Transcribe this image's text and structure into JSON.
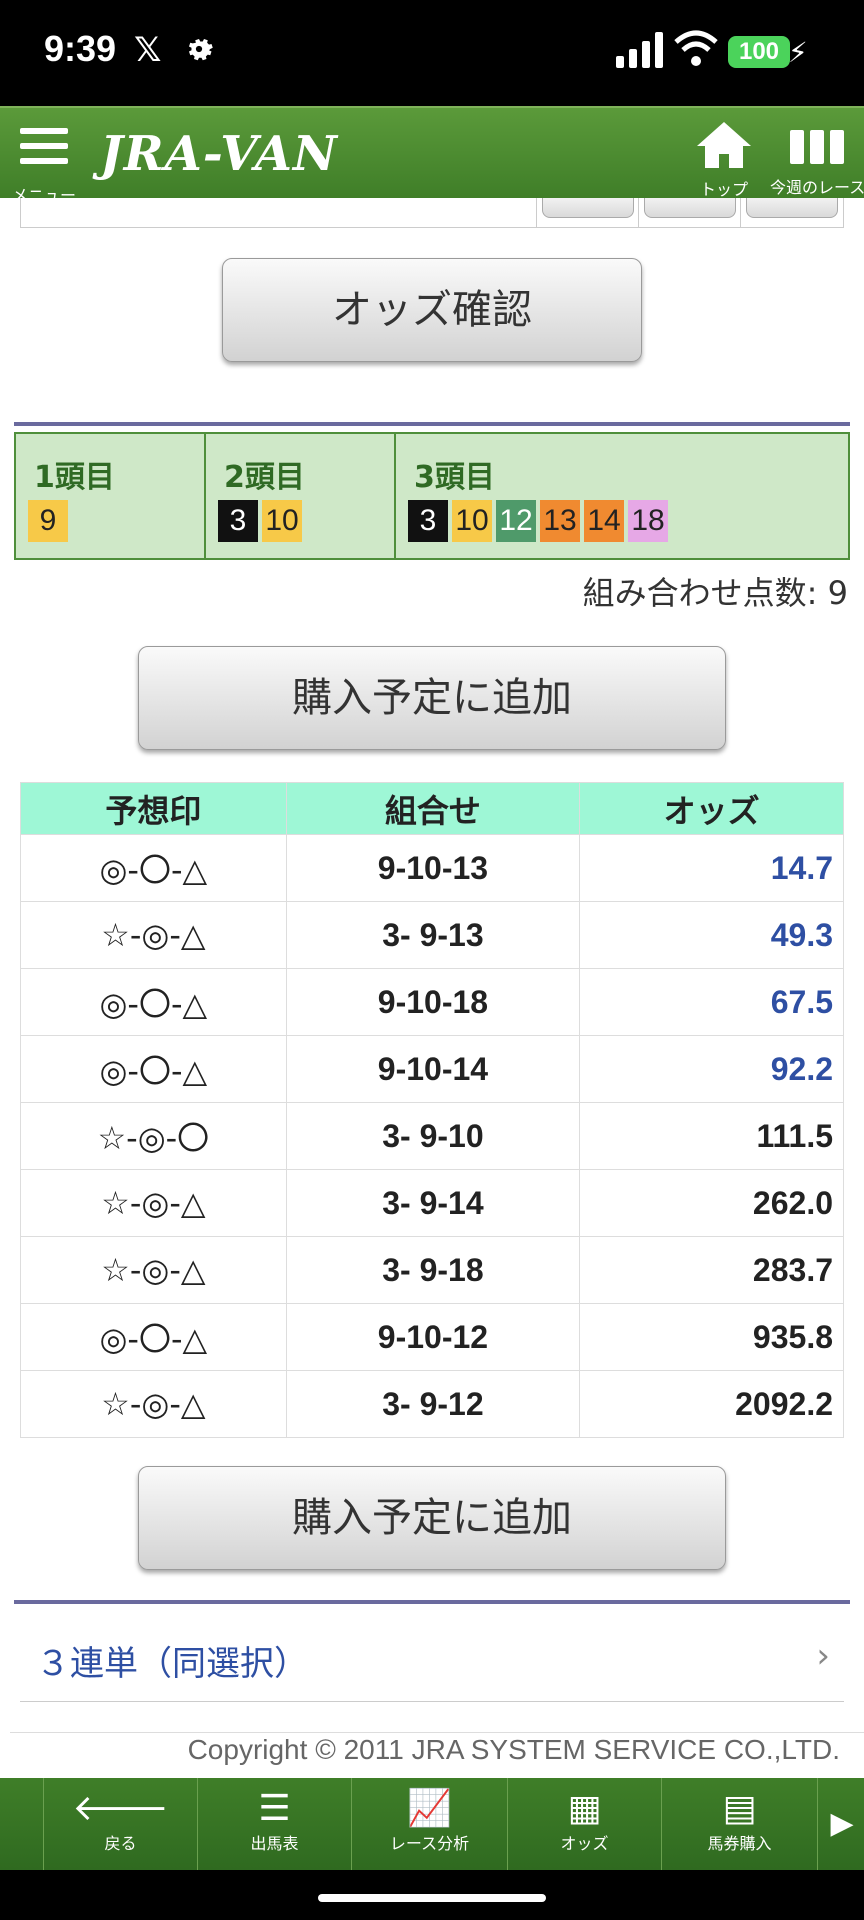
{
  "status": {
    "time": "9:39",
    "battery": "100"
  },
  "header": {
    "menu_label": "メニュー",
    "logo": "JRA-VAN",
    "top_label": "トップ",
    "week_label": "今週のレース"
  },
  "odds_confirm_label": "オッズ確認",
  "selection": {
    "cols": [
      {
        "title": "1頭目",
        "nums": [
          {
            "n": "9",
            "bg": "#f7c948",
            "fg": "#222"
          }
        ]
      },
      {
        "title": "2頭目",
        "nums": [
          {
            "n": "3",
            "bg": "#111111",
            "fg": "#fff"
          },
          {
            "n": "10",
            "bg": "#f7c948",
            "fg": "#222"
          }
        ]
      },
      {
        "title": "3頭目",
        "nums": [
          {
            "n": "3",
            "bg": "#111111",
            "fg": "#fff"
          },
          {
            "n": "10",
            "bg": "#f7c948",
            "fg": "#222"
          },
          {
            "n": "12",
            "bg": "#4f9a6a",
            "fg": "#fff"
          },
          {
            "n": "13",
            "bg": "#f08a30",
            "fg": "#222"
          },
          {
            "n": "14",
            "bg": "#f08a30",
            "fg": "#222"
          },
          {
            "n": "18",
            "bg": "#e6a8e6",
            "fg": "#222"
          }
        ]
      }
    ],
    "count_text": "組み合わせ点数: 9"
  },
  "add_button_label": "購入予定に追加",
  "table": {
    "headers": [
      "予想印",
      "組合せ",
      "オッズ"
    ],
    "rows": [
      {
        "mark": "◎-〇-△",
        "combo": "9-10-13",
        "odds": "14.7",
        "blue": true
      },
      {
        "mark": "☆-◎-△",
        "combo": "3- 9-13",
        "odds": "49.3",
        "blue": true
      },
      {
        "mark": "◎-〇-△",
        "combo": "9-10-18",
        "odds": "67.5",
        "blue": true
      },
      {
        "mark": "◎-〇-△",
        "combo": "9-10-14",
        "odds": "92.2",
        "blue": true
      },
      {
        "mark": "☆-◎-〇",
        "combo": "3- 9-10",
        "odds": "111.5",
        "blue": false
      },
      {
        "mark": "☆-◎-△",
        "combo": "3- 9-14",
        "odds": "262.0",
        "blue": false
      },
      {
        "mark": "☆-◎-△",
        "combo": "3- 9-18",
        "odds": "283.7",
        "blue": false
      },
      {
        "mark": "◎-〇-△",
        "combo": "9-10-12",
        "odds": "935.8",
        "blue": false
      },
      {
        "mark": "☆-◎-△",
        "combo": "3- 9-12",
        "odds": "2092.2",
        "blue": false
      }
    ]
  },
  "link_label": "３連単（同選択）",
  "copyright": "Copyright © 2011 JRA SYSTEM SERVICE CO.,LTD.",
  "bottom_nav": [
    {
      "label": "戻る",
      "icon": "back-arrow-icon"
    },
    {
      "label": "出馬表",
      "icon": "list-icon"
    },
    {
      "label": "レース分析",
      "icon": "analysis-icon"
    },
    {
      "label": "オッズ",
      "icon": "odds-icon"
    },
    {
      "label": "馬券購入",
      "icon": "ticket-icon"
    }
  ]
}
